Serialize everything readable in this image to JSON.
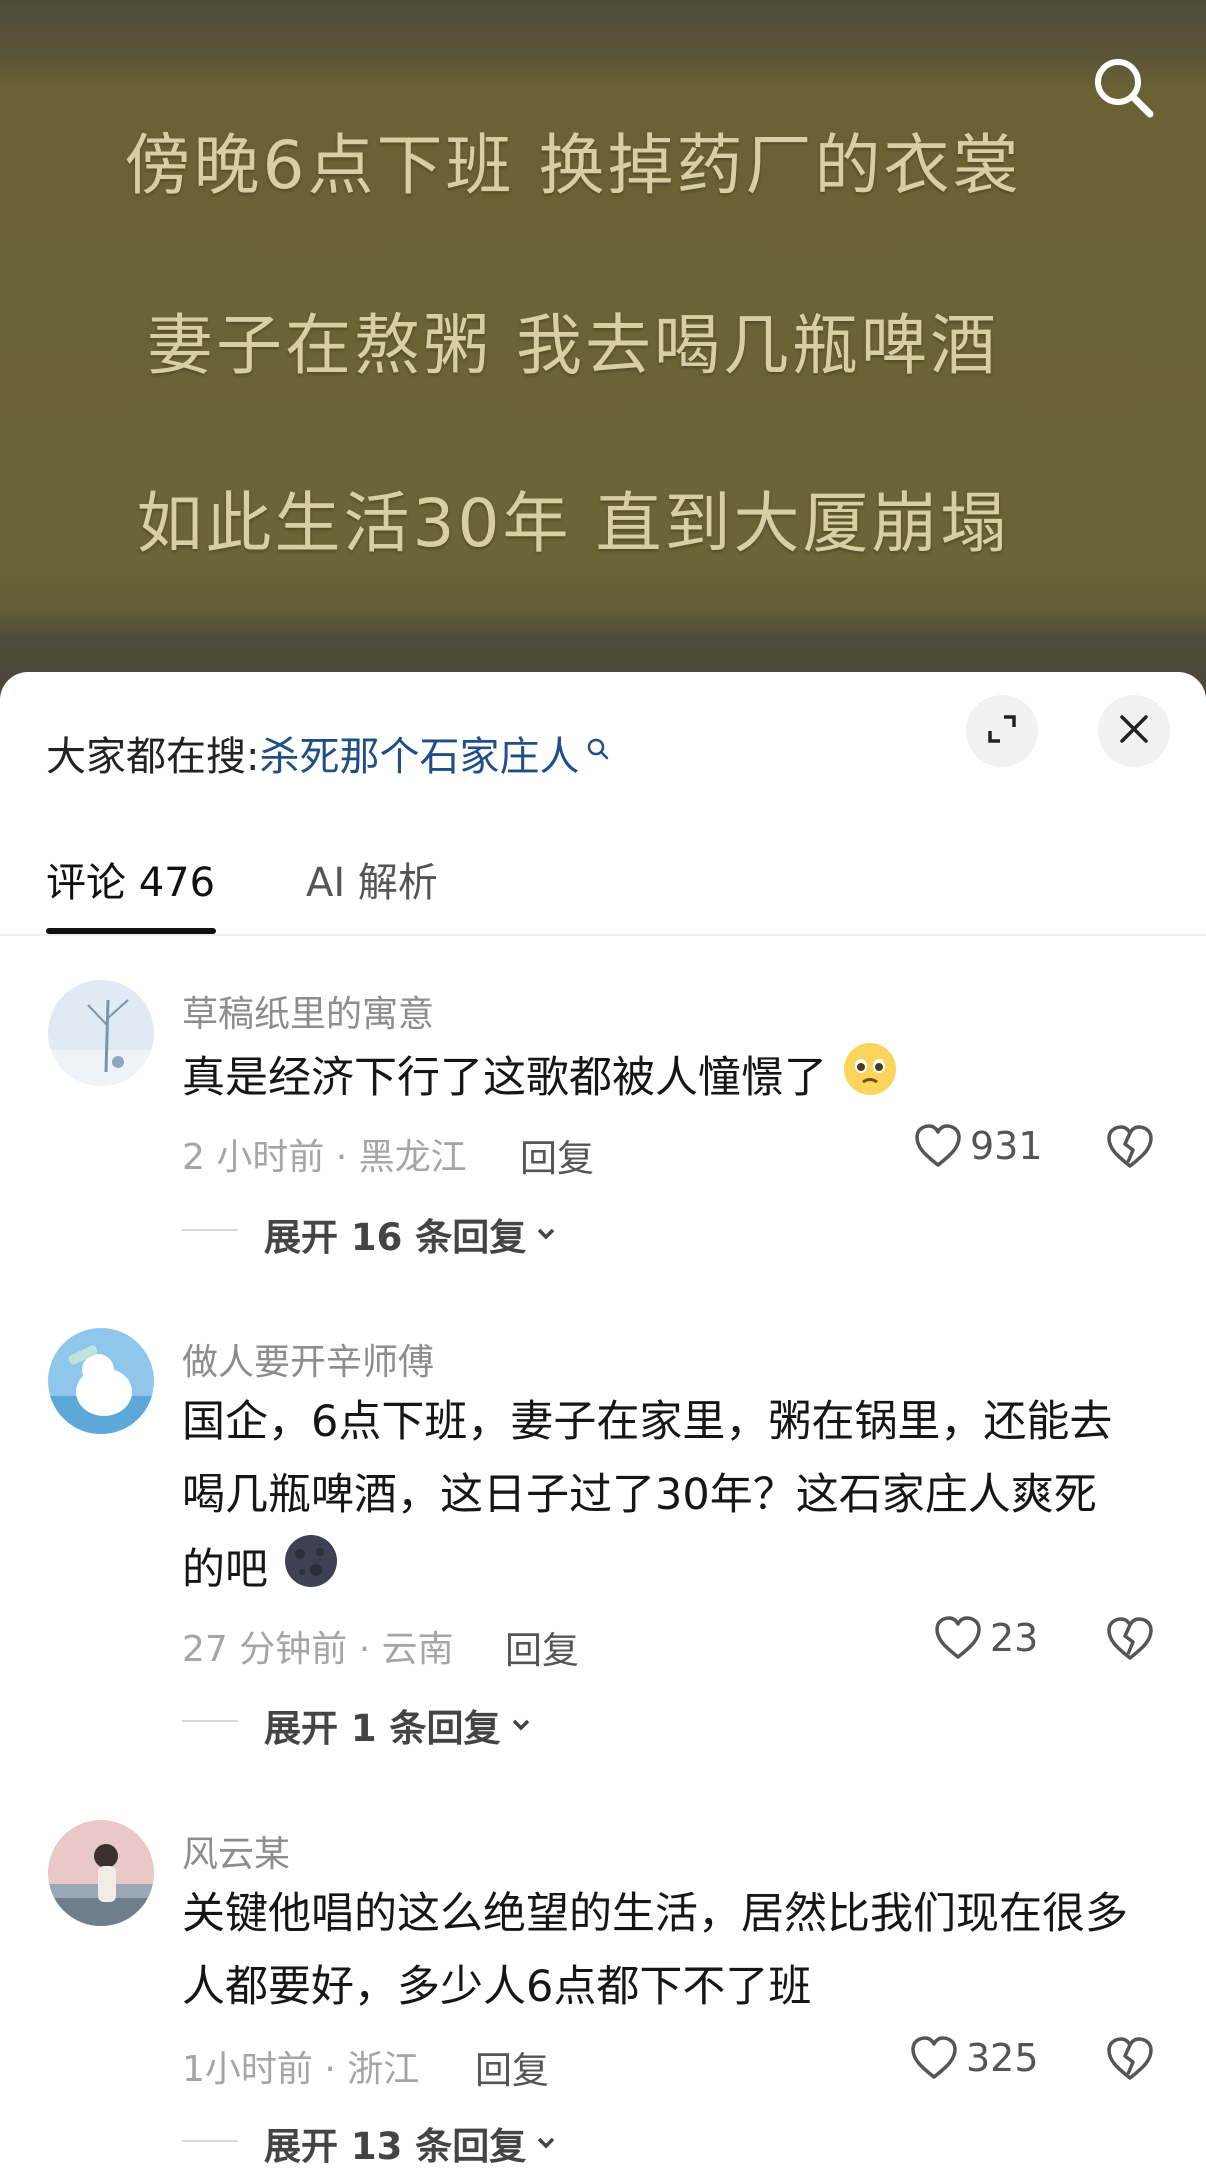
{
  "video": {
    "lyrics": [
      "傍晚6点下班 换掉药厂的衣裳",
      "妻子在熬粥 我去喝几瓶啤酒",
      "如此生活30年 直到大厦崩塌"
    ],
    "search_icon": "search-icon"
  },
  "panel": {
    "search_hint_label": "大家都在搜:",
    "search_hint_query": "杀死那个石家庄人",
    "expand_icon": "expand-icon",
    "close_icon": "close-icon"
  },
  "tabs": [
    {
      "label": "评论 476",
      "active": true
    },
    {
      "label": "AI 解析",
      "active": false
    }
  ],
  "comments": [
    {
      "username": "草稿纸里的寓意",
      "text": "真是经济下行了这歌都被人憧憬了",
      "emoji": "pleading-face-emoji",
      "meta": "2 小时前 · 黑龙江",
      "reply_label": "回复",
      "likes": "931",
      "expand_label": "展开 16 条回复"
    },
    {
      "username": "做人要开辛师傅",
      "text_lines": [
        "国企，6点下班，妻子在家里，粥在锅里，还能去",
        "喝几瓶啤酒，这日子过了30年？这石家庄人爽死",
        "的吧"
      ],
      "emoji": "new-moon-face-emoji",
      "meta": "27 分钟前 · 云南",
      "reply_label": "回复",
      "likes": "23",
      "expand_label": "展开 1 条回复"
    },
    {
      "username": "风云某",
      "text_lines": [
        "关键他唱的这么绝望的生活，居然比我们现在很多",
        "人都要好，多少人6点都下不了班"
      ],
      "meta": "1小时前 · 浙江",
      "reply_label": "回复",
      "likes": "325",
      "expand_label": "展开 13 条回复"
    }
  ],
  "colors": {
    "video_bg": "#6b6434",
    "lyric_text": "#d7cfa2",
    "link": "#1f4f86",
    "meta": "#a5a5a5"
  }
}
